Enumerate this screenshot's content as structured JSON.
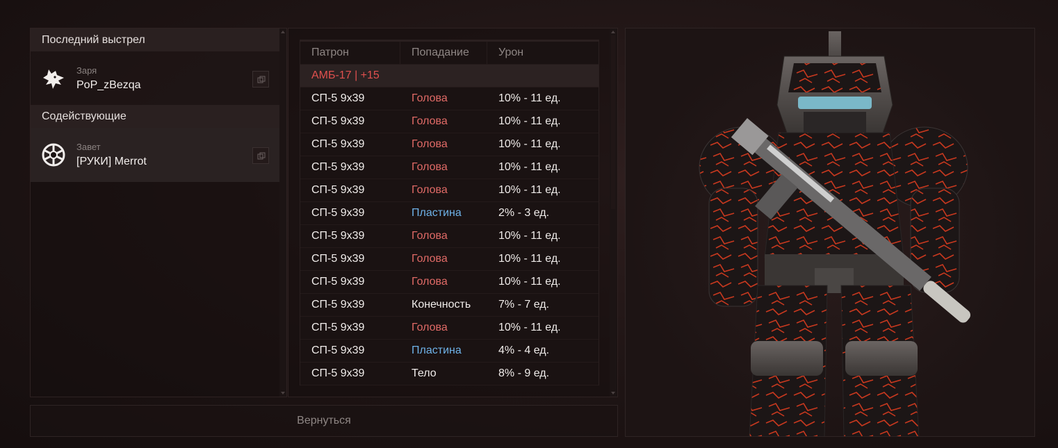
{
  "left": {
    "last_shot_heading": "Последний выстрел",
    "killer": {
      "faction": "Заря",
      "name": "PoP_zBezqa",
      "emblem": "wolf-emblem-icon"
    },
    "assistants_heading": "Содействующие",
    "assistant": {
      "faction": "Завет",
      "name": "[РУКИ] Merrot",
      "emblem": "covenant-emblem-icon"
    }
  },
  "table": {
    "headers": {
      "ammo": "Патрон",
      "hit": "Попадание",
      "damage": "Урон"
    },
    "weapon": "АМБ-17 | +15",
    "rows": [
      {
        "ammo": "СП-5 9x39",
        "hit": "Голова",
        "hit_type": "red",
        "damage": "10% - 11 ед."
      },
      {
        "ammo": "СП-5 9x39",
        "hit": "Голова",
        "hit_type": "red",
        "damage": "10% - 11 ед."
      },
      {
        "ammo": "СП-5 9x39",
        "hit": "Голова",
        "hit_type": "red",
        "damage": "10% - 11 ед."
      },
      {
        "ammo": "СП-5 9x39",
        "hit": "Голова",
        "hit_type": "red",
        "damage": "10% - 11 ед."
      },
      {
        "ammo": "СП-5 9x39",
        "hit": "Голова",
        "hit_type": "red",
        "damage": "10% - 11 ед."
      },
      {
        "ammo": "СП-5 9x39",
        "hit": "Пластина",
        "hit_type": "blue",
        "damage": "2% - 3 ед."
      },
      {
        "ammo": "СП-5 9x39",
        "hit": "Голова",
        "hit_type": "red",
        "damage": "10% - 11 ед."
      },
      {
        "ammo": "СП-5 9x39",
        "hit": "Голова",
        "hit_type": "red",
        "damage": "10% - 11 ед."
      },
      {
        "ammo": "СП-5 9x39",
        "hit": "Голова",
        "hit_type": "red",
        "damage": "10% - 11 ед."
      },
      {
        "ammo": "СП-5 9x39",
        "hit": "Конечность",
        "hit_type": "white",
        "damage": "7% - 7 ед."
      },
      {
        "ammo": "СП-5 9x39",
        "hit": "Голова",
        "hit_type": "red",
        "damage": "10% - 11 ед."
      },
      {
        "ammo": "СП-5 9x39",
        "hit": "Пластина",
        "hit_type": "blue",
        "damage": "4% - 4 ед."
      },
      {
        "ammo": "СП-5 9x39",
        "hit": "Тело",
        "hit_type": "white",
        "damage": "8% - 9 ед."
      }
    ]
  },
  "return_button": "Вернуться",
  "colors": {
    "accent_red": "#e06a66",
    "accent_blue": "#6eb2e8",
    "weapon_red": "#e0504e"
  }
}
